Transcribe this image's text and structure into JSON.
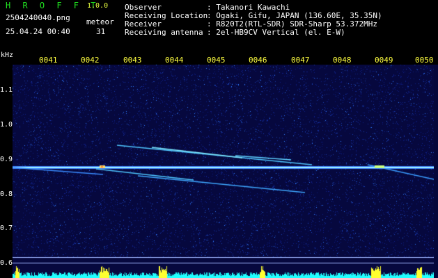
{
  "app": {
    "title": "H R O F F T",
    "version": "1.0.0",
    "filename": "2504240040.png",
    "datetime": "25.04.24 00:40",
    "meteor_label": "meteor",
    "meteor_count": "31"
  },
  "info": [
    {
      "key": "Observer",
      "value": ": Takanori Kawachi"
    },
    {
      "key": "Receiving Location",
      "value": ": Ogaki, Gifu, JAPAN (136.60E, 35.35N)"
    },
    {
      "key": "Receiver",
      "value": ": R820T2(RTL-SDR) SDR-Sharp 53.372MHz"
    },
    {
      "key": "Receiving antenna",
      "value": ": 2el-HB9CV Vertical (el. E-W)"
    }
  ],
  "axis": {
    "unit": "kHz",
    "time_ticks": [
      "0041",
      "0042",
      "0043",
      "0044",
      "0045",
      "0046",
      "0047",
      "0048",
      "0049",
      "0050"
    ],
    "freq_ticks": [
      "1.1",
      "1.0",
      "0.9",
      "0.8",
      "0.7",
      "0.6"
    ]
  },
  "colors": {
    "background": "#000000",
    "spectrogram_bg": "#06083e",
    "carrier": "#9ff4ff",
    "meteor_trail": "#60e0ff",
    "level_bars": "#20ffff",
    "level_peaks": "#ffff30",
    "tick_labels": "#ffff40"
  }
}
